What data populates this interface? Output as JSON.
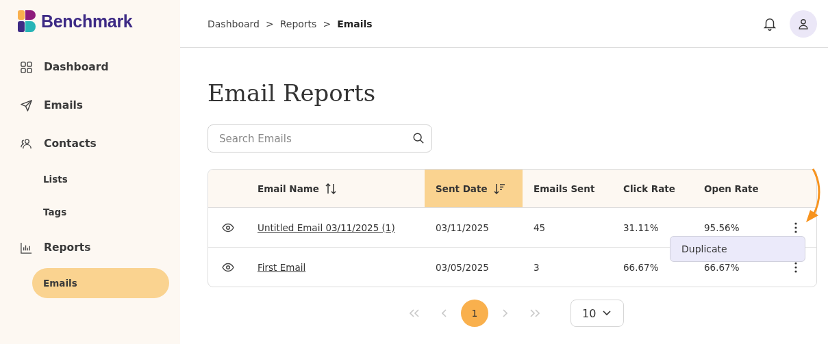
{
  "brand": {
    "name": "Benchmark"
  },
  "sidebar": {
    "items": [
      {
        "label": "Dashboard",
        "kind": "grid",
        "selected": false
      },
      {
        "label": "Emails",
        "kind": "send",
        "selected": false
      },
      {
        "label": "Contacts",
        "kind": "people",
        "selected": false,
        "children": [
          {
            "label": "Lists",
            "selected": false
          },
          {
            "label": "Tags",
            "selected": false
          }
        ]
      },
      {
        "label": "Reports",
        "kind": "chart",
        "selected": false,
        "children": [
          {
            "label": "Emails",
            "selected": true
          }
        ]
      }
    ]
  },
  "breadcrumb": [
    {
      "label": "Dashboard",
      "current": false
    },
    {
      "label": "Reports",
      "current": false
    },
    {
      "label": "Emails",
      "current": true
    }
  ],
  "breadcrumb_separator": ">",
  "page_title": "Email Reports",
  "search": {
    "placeholder": "Search Emails"
  },
  "table": {
    "columns": [
      {
        "label": "Email Name",
        "kind": "sortable",
        "selected": false
      },
      {
        "label": "Sent Date",
        "kind": "sorted_desc",
        "selected": true
      },
      {
        "label": "Emails Sent",
        "kind": "plain",
        "selected": false
      },
      {
        "label": "Click Rate",
        "kind": "plain",
        "selected": false
      },
      {
        "label": "Open Rate",
        "kind": "plain",
        "selected": false
      }
    ],
    "rows": [
      {
        "name": "Untitled Email 03/11/2025 (1)",
        "sent_date": "03/11/2025",
        "emails_sent": "45",
        "click_rate": "31.11%",
        "open_rate": "95.56%",
        "menu_open": true
      },
      {
        "name": "First Email",
        "sent_date": "03/05/2025",
        "emails_sent": "3",
        "click_rate": "66.67%",
        "open_rate": "66.67%",
        "menu_open": false
      }
    ]
  },
  "row_menu": {
    "items": [
      "Duplicate"
    ]
  },
  "pagination": {
    "first_disabled": true,
    "prev_disabled": true,
    "next_disabled": true,
    "last_disabled": true,
    "pages": [
      {
        "label": "1",
        "selected": true
      }
    ],
    "page_size": "10"
  }
}
